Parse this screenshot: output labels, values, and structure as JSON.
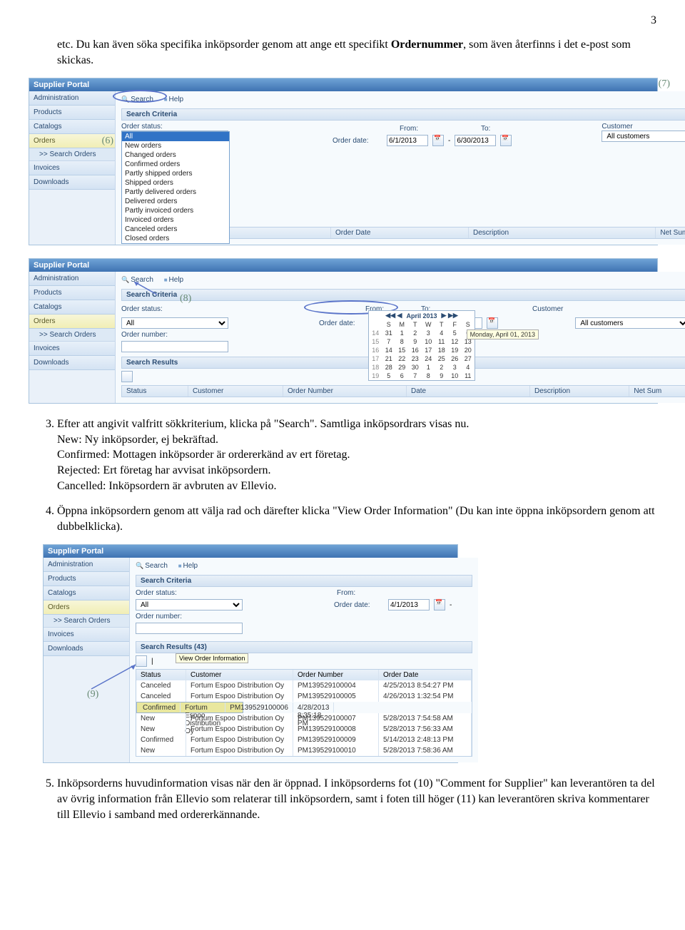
{
  "page_number": "3",
  "intro": {
    "pre": "etc. Du kan även söka specifika inköpsorder genom att ange ett specifikt ",
    "bold": "Ordernummer",
    "post": ", som även återfinns i det e-post som skickas."
  },
  "item3": {
    "lead": "Efter att angivit valfritt sökkriterium, klicka på \"Search\". Samtliga inköpsordrars visas nu.",
    "new": "New: Ny inköpsorder, ej bekräftad.",
    "confirmed": "Confirmed: Mottagen inköpsorder är ordererkänd av ert företag.",
    "rejected": "Rejected: Ert företag har avvisat inköpsordern.",
    "cancelled": "Cancelled: Inköpsordern är avbruten av Ellevio."
  },
  "item4": "Öppna inköpsordern genom att välja rad och därefter klicka \"View Order Information\" (Du kan inte öppna inköpsordern genom att dubbelklicka).",
  "item5": "Inköpsorderns huvudinformation visas när den är öppnad. I inköpsorderns fot (10) \"Comment for Supplier\" kan leverantören ta del av övrig information från Ellevio som relaterar till inköpsordern, samt i foten till höger (11) kan leverantören skriva kommentarer till Ellevio i samband med ordererkännande.",
  "portal": {
    "title": "Supplier Portal",
    "nav": {
      "admin": "Administration",
      "products": "Products",
      "catalogs": "Catalogs",
      "orders": "Orders",
      "search_orders": "Search Orders",
      "invoices": "Invoices",
      "downloads": "Downloads"
    }
  },
  "toolbar": {
    "search": "Search",
    "help": "Help"
  },
  "labels": {
    "search_criteria": "Search Criteria",
    "order_status": "Order status:",
    "order_date": "Order date:",
    "from": "From:",
    "to": "To:",
    "customer": "Customer",
    "order_number": "Order number:",
    "search_results": "Search Results",
    "search_results_43": "Search Results (43)",
    "all_customers": "All customers",
    "all": "All",
    "sub_search": ">> Search Orders"
  },
  "dates": {
    "from1": "6/1/2013",
    "to1": "6/30/2013",
    "from2": "4/1/2013",
    "to2": "6/30/2013",
    "from3": "4/1/2013"
  },
  "cols": {
    "status": "Status",
    "customer": "Customer",
    "order_number": "Order Number",
    "order_date": "Order Date",
    "description": "Description",
    "net_sum": "Net Sum",
    "date": "Date"
  },
  "dropdown": [
    "All",
    "New orders",
    "Changed orders",
    "Confirmed orders",
    "Partly shipped orders",
    "Shipped orders",
    "Partly delivered orders",
    "Delivered orders",
    "Partly invoiced orders",
    "Invoiced orders",
    "Canceled orders",
    "Closed orders"
  ],
  "datepicker": {
    "month": "April 2013",
    "dow": [
      "S",
      "M",
      "T",
      "W",
      "T",
      "F",
      "S"
    ],
    "rows": [
      [
        "14",
        "31",
        "1",
        "2",
        "3",
        "4",
        "5",
        "6"
      ],
      [
        "15",
        "7",
        "8",
        "9",
        "10",
        "11",
        "12",
        "13"
      ],
      [
        "16",
        "14",
        "15",
        "16",
        "17",
        "18",
        "19",
        "20"
      ],
      [
        "17",
        "21",
        "22",
        "23",
        "24",
        "25",
        "26",
        "27"
      ],
      [
        "18",
        "28",
        "29",
        "30",
        "1",
        "2",
        "3",
        "4"
      ],
      [
        "19",
        "5",
        "6",
        "7",
        "8",
        "9",
        "10",
        "11"
      ]
    ],
    "tip": "Monday, April 01, 2013"
  },
  "tooltip_view": "View Order Information",
  "results": [
    {
      "status": "Canceled",
      "cust": "Fortum Espoo Distribution Oy",
      "num": "PM139529100004",
      "date": "4/25/2013 8:54:27 PM"
    },
    {
      "status": "Canceled",
      "cust": "Fortum Espoo Distribution Oy",
      "num": "PM139529100005",
      "date": "4/26/2013 1:32:54 PM"
    },
    {
      "status": "Confirmed",
      "cust": "Fortum Espoo Distribution Oy",
      "num": "PM139529100006",
      "date": "4/28/2013 8:35:18 PM"
    },
    {
      "status": "New",
      "cust": "Fortum Espoo Distribution Oy",
      "num": "PM139529100007",
      "date": "5/28/2013 7:54:58 AM"
    },
    {
      "status": "New",
      "cust": "Fortum Espoo Distribution Oy",
      "num": "PM139529100008",
      "date": "5/28/2013 7:56:33 AM"
    },
    {
      "status": "Confirmed",
      "cust": "Fortum Espoo Distribution Oy",
      "num": "PM139529100009",
      "date": "5/14/2013 2:48:13 PM"
    },
    {
      "status": "New",
      "cust": "Fortum Espoo Distribution Oy",
      "num": "PM139529100010",
      "date": "5/28/2013 7:58:36 AM"
    }
  ],
  "ann": {
    "six": "(6)",
    "seven": "(7)",
    "eight": "(8)",
    "nine": "(9)"
  }
}
